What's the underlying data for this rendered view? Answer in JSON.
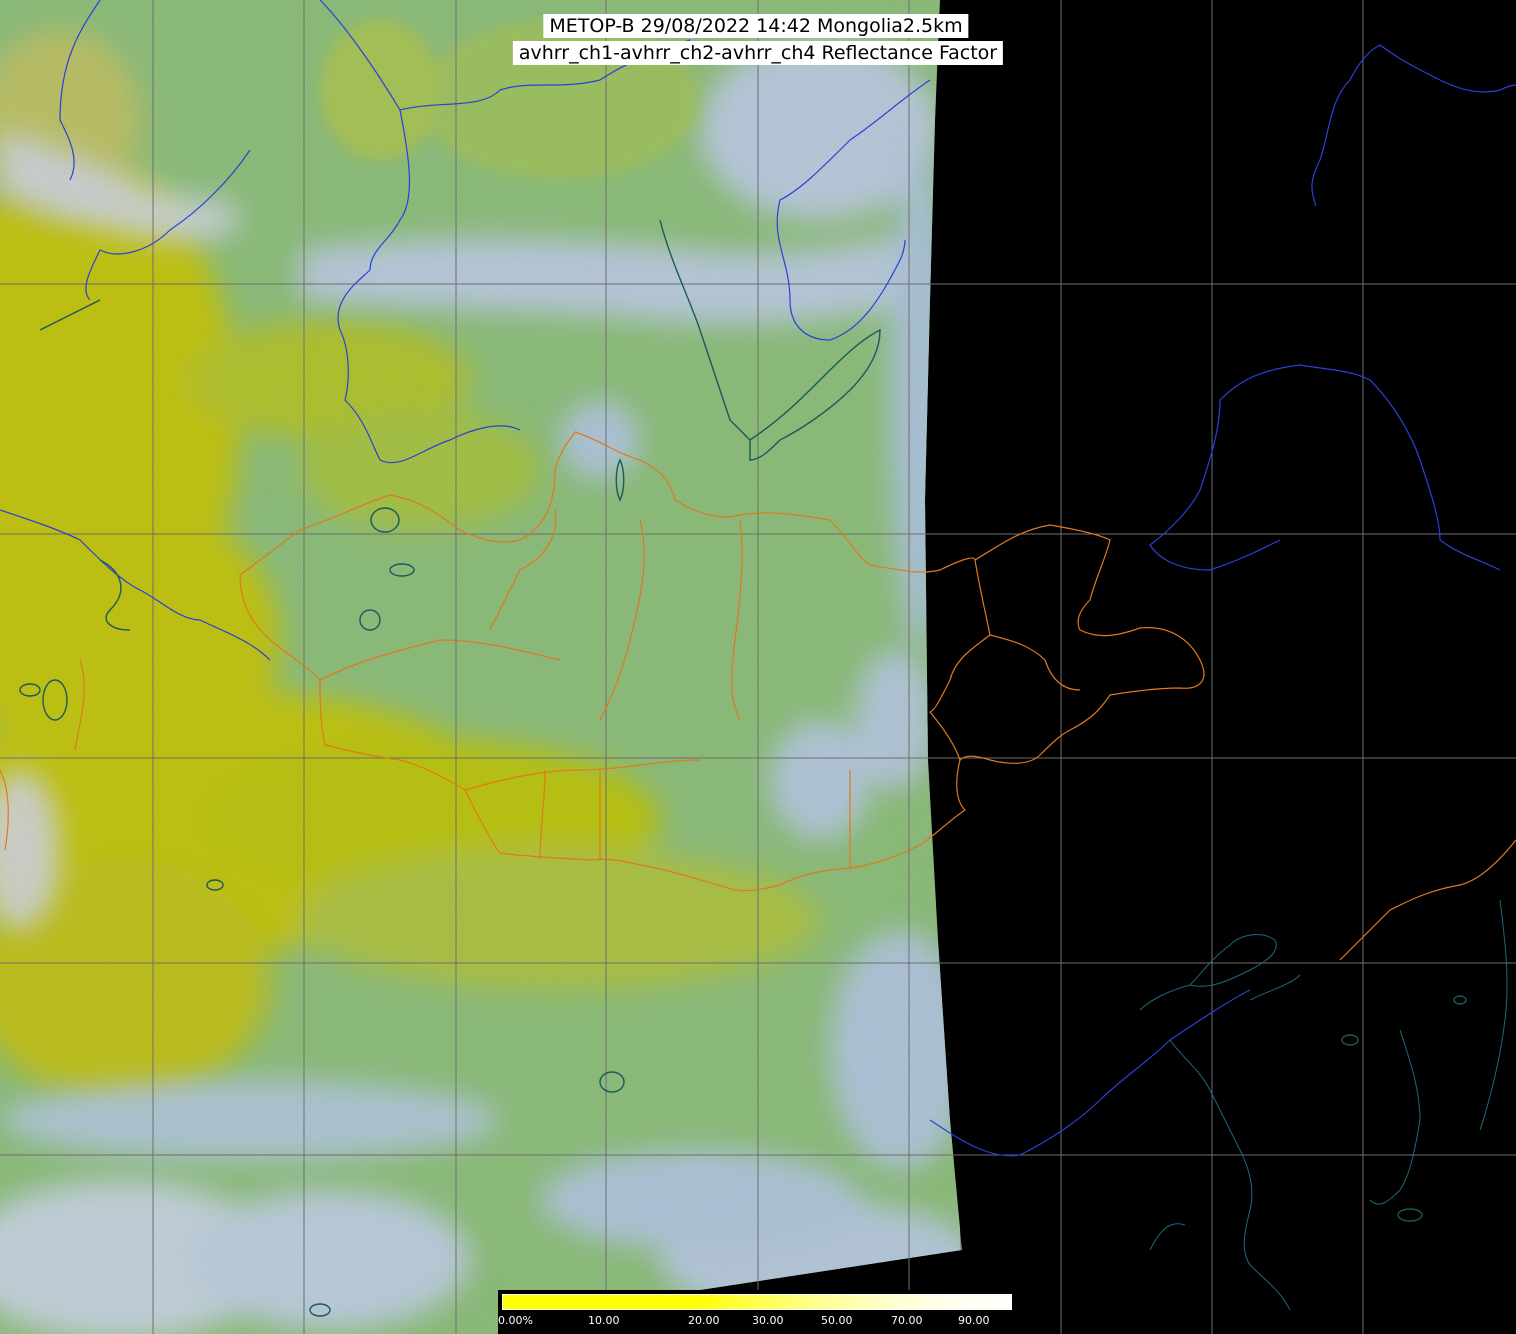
{
  "title": {
    "line1": "METOP-B 29/08/2022 14:42 Mongolia2.5km",
    "line2": "avhrr_ch1-avhrr_ch2-avhrr_ch4 Reflectance Factor"
  },
  "colorbar": {
    "labels": [
      "0.00%",
      "10.00",
      "20.00",
      "30.00",
      "50.00",
      "70.00",
      "90.00"
    ]
  },
  "colors": {
    "background": "#000000",
    "grid": "#6e6e6e",
    "coastline": "#2233cc",
    "country_border": "#e07820",
    "lake": "#1a5a5a",
    "high_reflectance": "#c8c800",
    "mid_reflectance": "#8cbe78",
    "cloud": "#b8c8f0"
  }
}
